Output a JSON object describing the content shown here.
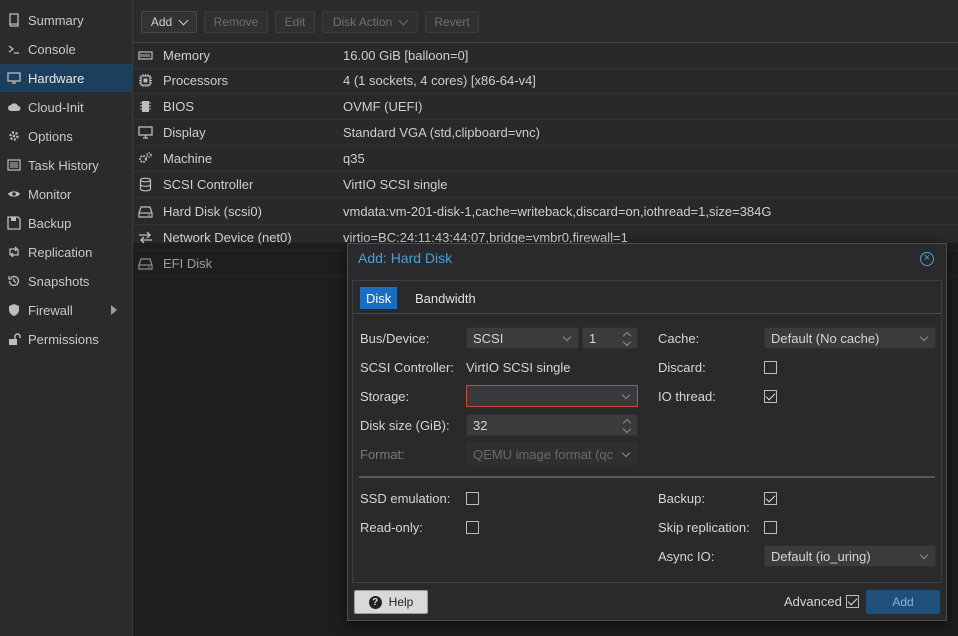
{
  "sidebar": {
    "items": [
      {
        "label": "Summary",
        "icon": "book-icon",
        "active": false
      },
      {
        "label": "Console",
        "icon": "terminal-icon",
        "active": false
      },
      {
        "label": "Hardware",
        "icon": "desktop-icon",
        "active": true
      },
      {
        "label": "Cloud-Init",
        "icon": "cloud-icon",
        "active": false
      },
      {
        "label": "Options",
        "icon": "gear-icon",
        "active": false
      },
      {
        "label": "Task History",
        "icon": "list-icon",
        "active": false
      },
      {
        "label": "Monitor",
        "icon": "eye-icon",
        "active": false
      },
      {
        "label": "Backup",
        "icon": "floppy-icon",
        "active": false
      },
      {
        "label": "Replication",
        "icon": "retweet-icon",
        "active": false
      },
      {
        "label": "Snapshots",
        "icon": "history-icon",
        "active": false
      },
      {
        "label": "Firewall",
        "icon": "shield-icon",
        "active": false
      },
      {
        "label": "Permissions",
        "icon": "unlock-icon",
        "active": false
      }
    ]
  },
  "toolbar": {
    "add": "Add",
    "remove": "Remove",
    "edit": "Edit",
    "disk_action": "Disk Action",
    "revert": "Revert"
  },
  "hardware": {
    "rows": [
      {
        "name": "Memory",
        "value": "16.00 GiB [balloon=0]",
        "icon": "memory-icon"
      },
      {
        "name": "Processors",
        "value": "4 (1 sockets, 4 cores) [x86-64-v4]",
        "icon": "cpu-icon"
      },
      {
        "name": "BIOS",
        "value": "OVMF (UEFI)",
        "icon": "microchip-icon"
      },
      {
        "name": "Display",
        "value": "Standard VGA (std,clipboard=vnc)",
        "icon": "monitor-icon"
      },
      {
        "name": "Machine",
        "value": "q35",
        "icon": "cogs-icon"
      },
      {
        "name": "SCSI Controller",
        "value": "VirtIO SCSI single",
        "icon": "database-icon"
      },
      {
        "name": "Hard Disk (scsi0)",
        "value": "vmdata:vm-201-disk-1,cache=writeback,discard=on,iothread=1,size=384G",
        "icon": "hdd-icon"
      },
      {
        "name": "Network Device (net0)",
        "value": "virtio=BC:24:11:43:44:07,bridge=vmbr0,firewall=1",
        "icon": "exchange-icon"
      },
      {
        "name": "EFI Disk",
        "value": "",
        "icon": "hdd-icon"
      }
    ]
  },
  "dialog": {
    "title": "Add: Hard Disk",
    "tabs": [
      "Disk",
      "Bandwidth"
    ],
    "bus_device_label": "Bus/Device:",
    "bus_value": "SCSI",
    "device_value": "1",
    "scsi_controller_label": "SCSI Controller:",
    "scsi_controller_value": "VirtIO SCSI single",
    "storage_label": "Storage:",
    "storage_value": "",
    "disk_size_label": "Disk size (GiB):",
    "disk_size_value": "32",
    "format_label": "Format:",
    "format_value": "QEMU image format (qc",
    "cache_label": "Cache:",
    "cache_value": "Default (No cache)",
    "discard_label": "Discard:",
    "discard_checked": false,
    "io_thread_label": "IO thread:",
    "io_thread_checked": true,
    "ssd_emulation_label": "SSD emulation:",
    "ssd_emulation_checked": false,
    "read_only_label": "Read-only:",
    "read_only_checked": false,
    "backup_label": "Backup:",
    "backup_checked": true,
    "skip_replication_label": "Skip replication:",
    "skip_replication_checked": false,
    "async_io_label": "Async IO:",
    "async_io_value": "Default (io_uring)",
    "help_label": "Help",
    "advanced_label": "Advanced",
    "advanced_checked": true,
    "add_label": "Add"
  },
  "colors": {
    "accent": "#4b9fd6",
    "active_nav": "#1b3f5c",
    "tab_active": "#1a6ec0",
    "invalid_border": "#c74a33"
  }
}
